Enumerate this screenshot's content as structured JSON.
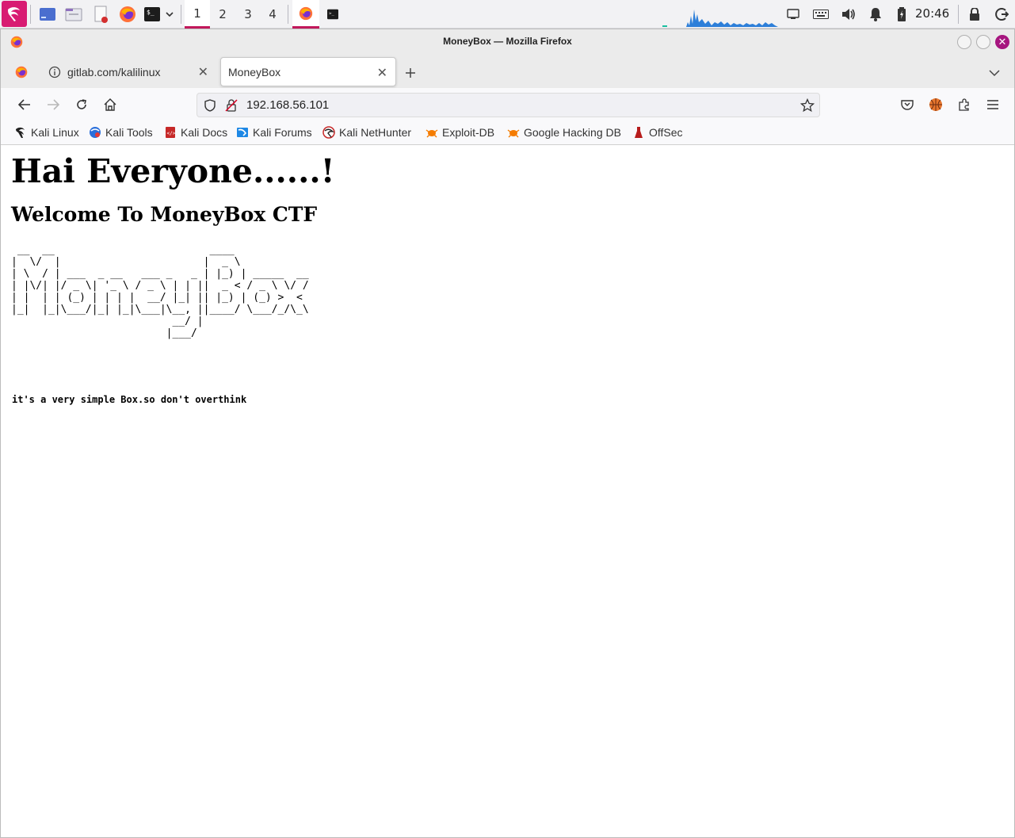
{
  "panel": {
    "workspaces": [
      "1",
      "2",
      "3",
      "4"
    ],
    "clock": "20:46"
  },
  "window": {
    "title": "MoneyBox — Mozilla Firefox"
  },
  "tabs": [
    {
      "label": "gitlab.com/kalilinux"
    },
    {
      "label": "MoneyBox"
    }
  ],
  "urlbar": {
    "url": "192.168.56.101"
  },
  "bookmarks": [
    {
      "label": "Kali Linux"
    },
    {
      "label": "Kali Tools"
    },
    {
      "label": "Kali Docs"
    },
    {
      "label": "Kali Forums"
    },
    {
      "label": "Kali NetHunter"
    },
    {
      "label": "Exploit-DB"
    },
    {
      "label": "Google Hacking DB"
    },
    {
      "label": "OffSec"
    }
  ],
  "page": {
    "heading": "Hai Everyone......!",
    "subheading": "Welcome To MoneyBox CTF",
    "ascii_art": " __  __                         ____            \n|  \\/  |                       |  _ \\           \n| \\  / | ___  _ __   ___ _   _ | |_) | _____  __\n| |\\/| |/ _ \\| '_ \\ / _ \\ | | ||  _ < / _ \\ \\/ /\n| |  | | (_) | | | |  __/ |_| || |_) | (_) >  < \n|_|  |_|\\___/|_| |_|\\___|\\__, ||____/ \\___/_/\\_\\\n                          __/ |                 \n                         |___/                  ",
    "hint": "it's a very simple Box.so don't overthink"
  },
  "colors": {
    "accent": "#c2185b",
    "kali_menu": "#d81b72"
  }
}
